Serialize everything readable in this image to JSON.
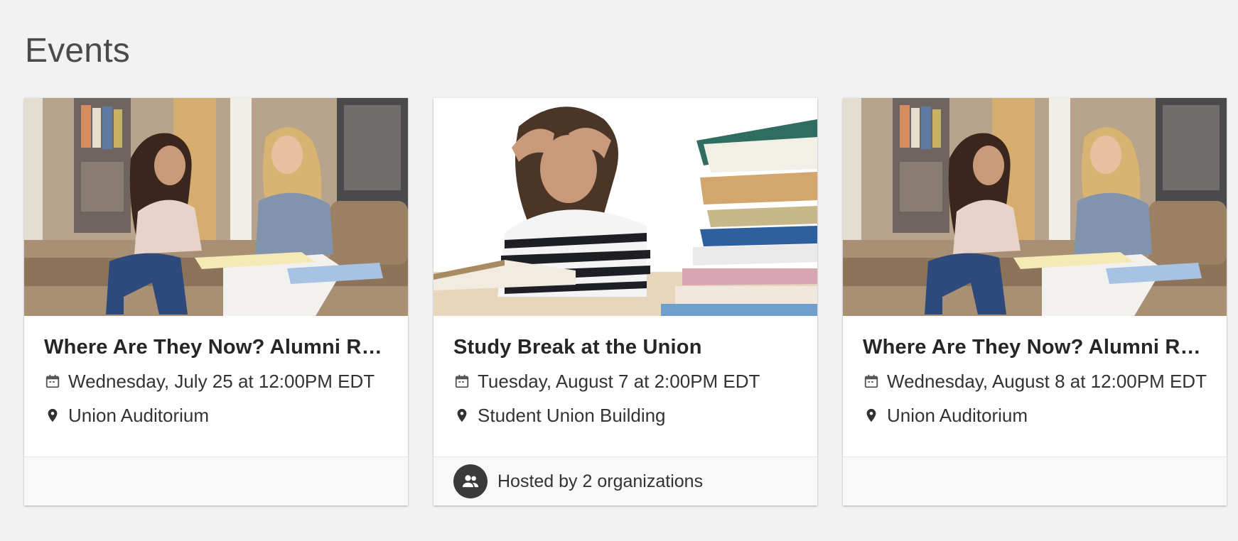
{
  "page": {
    "title": "Events"
  },
  "events": [
    {
      "title": "Where Are They Now? Alumni Rou...",
      "date": "Wednesday, July 25 at 12:00PM EDT",
      "location": "Union Auditorium",
      "image": "two-students-studying-photo",
      "hosted_by": ""
    },
    {
      "title": "Study Break at the Union",
      "date": "Tuesday, August 7 at 2:00PM EDT",
      "location": "Student Union Building",
      "image": "stressed-student-with-books-photo",
      "hosted_by": "Hosted by 2 organizations"
    },
    {
      "title": "Where Are They Now? Alumni Rou...",
      "date": "Wednesday, August 8 at 12:00PM EDT",
      "location": "Union Auditorium",
      "image": "two-students-studying-photo",
      "hosted_by": ""
    }
  ],
  "icons": {
    "date": "calendar-icon",
    "location": "map-pin-icon",
    "host": "group-icon"
  },
  "colors": {
    "background": "#f2f2f2",
    "card": "#ffffff",
    "footer": "#f8f8f8",
    "avatar": "#3a3a3a"
  }
}
